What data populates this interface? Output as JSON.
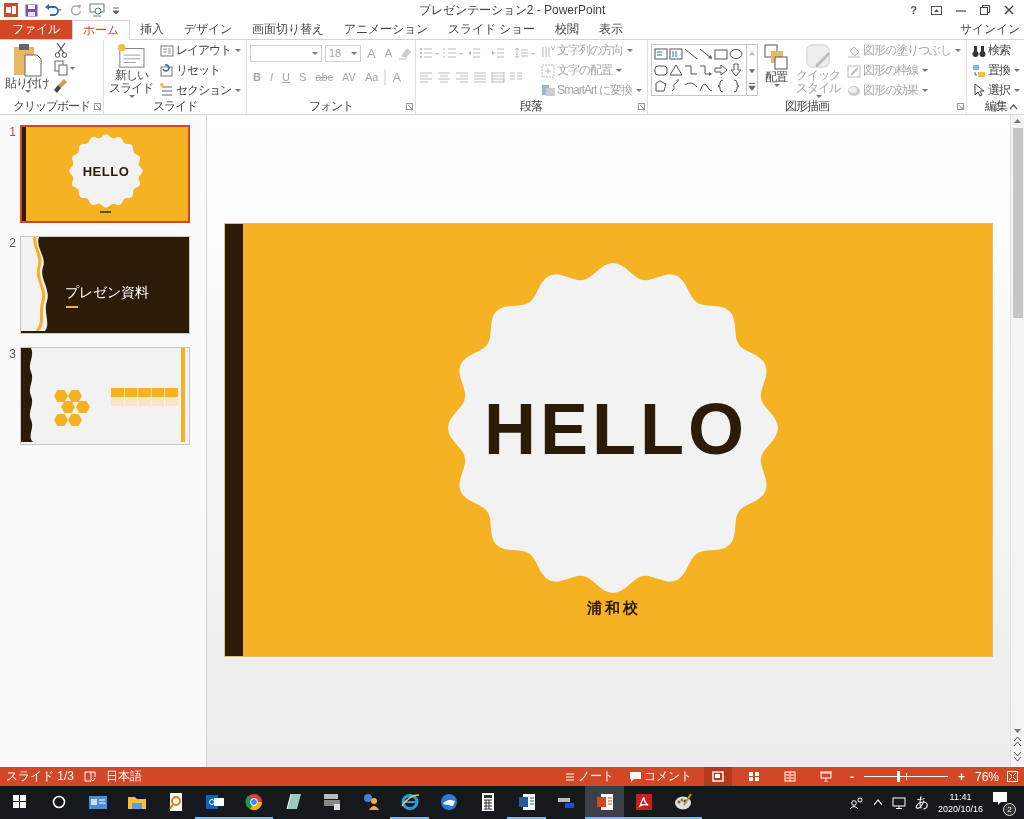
{
  "title_bar": {
    "title": "プレゼンテーション2 - PowerPoint",
    "help": "?"
  },
  "tabs": [
    {
      "label": "ファイル",
      "kind": "file",
      "selected": false
    },
    {
      "label": "ホーム",
      "kind": "tab",
      "selected": true
    },
    {
      "label": "挿入",
      "kind": "tab",
      "selected": false
    },
    {
      "label": "デザイン",
      "kind": "tab",
      "selected": false
    },
    {
      "label": "画面切り替え",
      "kind": "tab",
      "selected": false
    },
    {
      "label": "アニメーション",
      "kind": "tab",
      "selected": false
    },
    {
      "label": "スライド ショー",
      "kind": "tab",
      "selected": false
    },
    {
      "label": "校閲",
      "kind": "tab",
      "selected": false
    },
    {
      "label": "表示",
      "kind": "tab",
      "selected": false
    }
  ],
  "sign_in": "サインイン",
  "ribbon": [
    {
      "kind": "clipboard",
      "label": "クリップボード",
      "paste": "貼り付け"
    },
    {
      "kind": "slides",
      "label": "スライド",
      "new_slide": [
        "新しい",
        "スライド"
      ],
      "commands": [
        {
          "label": "レイアウト"
        },
        {
          "label": "リセット"
        },
        {
          "label": "セクション"
        }
      ]
    },
    {
      "kind": "font",
      "label": "フォント",
      "disabled": true,
      "font_size": "18",
      "glyphs": [
        "A",
        "A",
        "B",
        "I",
        "U",
        "S",
        "abc",
        "AV",
        "Aa",
        "A"
      ]
    },
    {
      "kind": "paragraph",
      "label": "段落",
      "disabled": true,
      "commands": [
        {
          "label": "文字列の方向"
        },
        {
          "label": "文字の配置"
        },
        {
          "label": "SmartArt に変換"
        }
      ]
    },
    {
      "kind": "drawing",
      "label": "図形描画",
      "arrange": "配置",
      "quick_styles": {
        "lines": [
          "クイック",
          "スタイル"
        ],
        "disabled": true
      },
      "commands": [
        {
          "label": "図形の塗りつぶし",
          "disabled": true
        },
        {
          "label": "図形の枠線",
          "disabled": true
        },
        {
          "label": "図形の効果",
          "disabled": true
        }
      ]
    },
    {
      "kind": "editing",
      "label": "編集",
      "commands": [
        {
          "label": "検索"
        },
        {
          "label": "置換"
        },
        {
          "label": "選択"
        }
      ]
    }
  ],
  "slides": [
    {
      "number": "1",
      "kind": "title",
      "selected": true,
      "title": "HELLO"
    },
    {
      "number": "2",
      "kind": "section",
      "selected": false,
      "title": "プレゼン資料"
    },
    {
      "number": "3",
      "kind": "content",
      "selected": false
    }
  ],
  "current_slide": {
    "title": "HELLO",
    "subtitle": "浦和校"
  },
  "status_bar": {
    "slide_indicator": "スライド 1/3",
    "language": "日本語",
    "notes": "ノート",
    "comments": "コメント",
    "views": [
      {
        "selected": true
      },
      {
        "selected": false
      },
      {
        "selected": false
      },
      {
        "selected": false
      }
    ],
    "zoom_out": "-",
    "zoom_in": "+",
    "zoom": {
      "level": 0.4,
      "reading": "76%"
    }
  },
  "taskbar": {
    "apps": [
      {
        "running": false,
        "active": false
      },
      {
        "running": false,
        "active": false
      },
      {
        "running": false,
        "active": false
      },
      {
        "running": true,
        "active": false
      },
      {
        "running": true,
        "active": false
      },
      {
        "running": false,
        "active": false
      },
      {
        "running": false,
        "active": false
      },
      {
        "running": false,
        "active": false
      },
      {
        "running": true,
        "active": false
      },
      {
        "running": false,
        "active": false
      },
      {
        "running": false,
        "active": false
      },
      {
        "running": true,
        "active": false
      },
      {
        "running": false,
        "active": false
      },
      {
        "running": true,
        "active": true
      },
      {
        "running": true,
        "active": false
      },
      {
        "running": true,
        "active": false
      }
    ],
    "ime": "あ",
    "time": "11:41",
    "date": "2020/10/16",
    "notifications": "2"
  }
}
